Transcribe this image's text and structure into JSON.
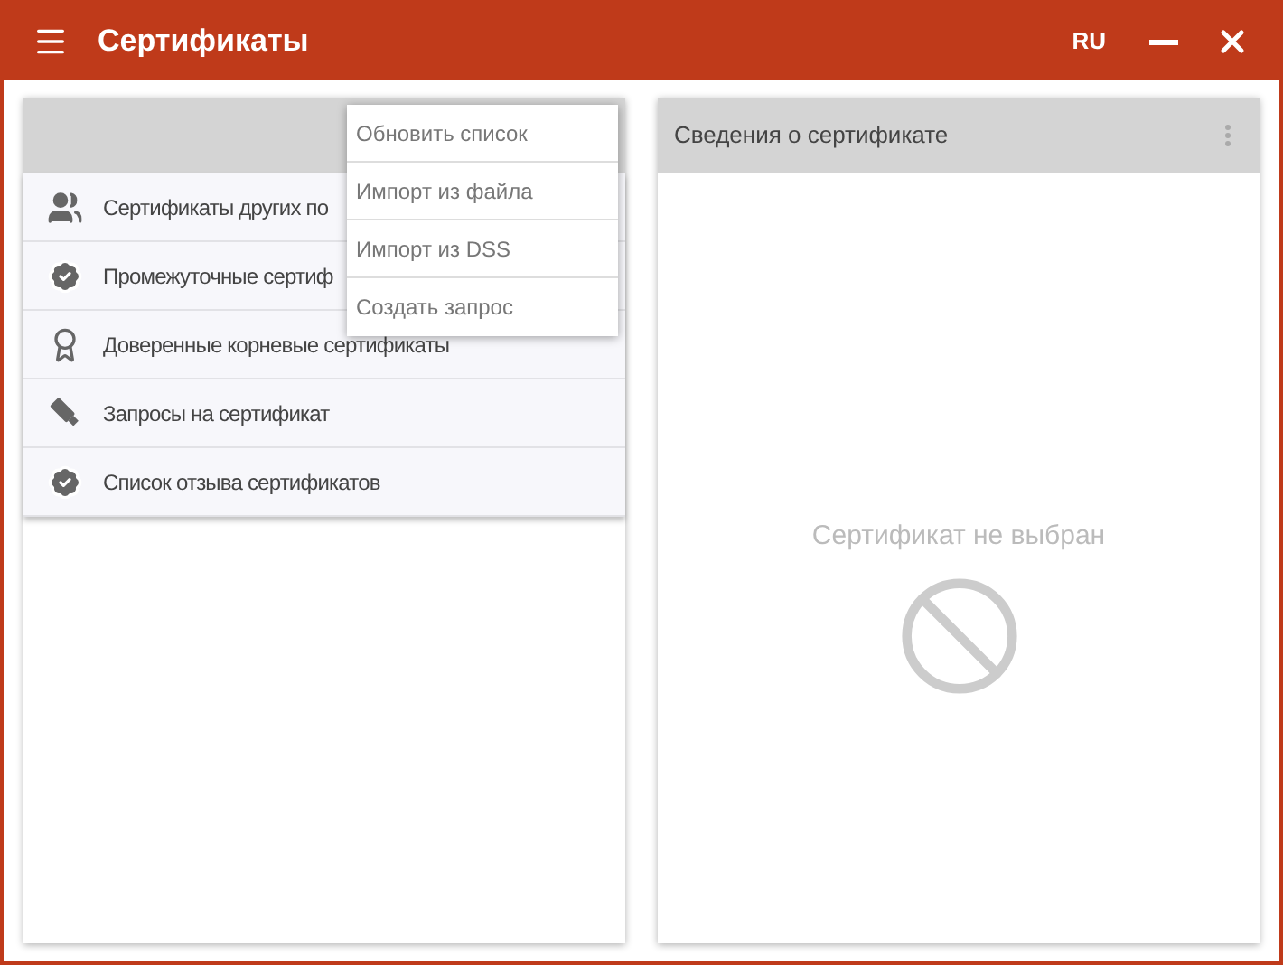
{
  "window": {
    "title": "Сертификаты",
    "language": "RU"
  },
  "left_panel": {
    "items": [
      {
        "label": "Сертификаты других по",
        "kind": "people"
      },
      {
        "label": "Промежуточные сертиф",
        "kind": "badge"
      },
      {
        "label": "Доверенные корневые сертификаты",
        "kind": "award"
      },
      {
        "label": "Запросы на сертификат",
        "kind": "stick"
      },
      {
        "label": "Список отзыва сертификатов",
        "kind": "badge"
      }
    ]
  },
  "menu": {
    "items": [
      "Обновить список",
      "Импорт из файла",
      "Импорт из DSS",
      "Создать запрос"
    ]
  },
  "right_panel": {
    "title": "Сведения о сертификате",
    "empty_text": "Сертификат не выбран"
  }
}
